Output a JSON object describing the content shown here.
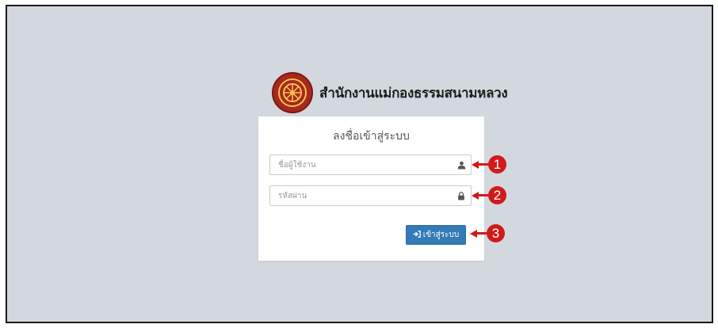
{
  "header": {
    "logo_icon": "dharma-wheel-seal-icon",
    "organization_name": "สำนักงานแม่กองธรรมสนามหลวง"
  },
  "login_form": {
    "title": "ลงชื่อเข้าสู่ระบบ",
    "username": {
      "placeholder": "ชื่อผู้ใช้งาน",
      "value": "",
      "icon": "user-icon"
    },
    "password": {
      "placeholder": "รหัสผ่าน",
      "value": "",
      "icon": "lock-icon"
    },
    "submit": {
      "label": "เข้าสู่ระบบ",
      "icon": "sign-in-icon"
    }
  },
  "annotations": [
    {
      "number": "1"
    },
    {
      "number": "2"
    },
    {
      "number": "3"
    }
  ],
  "colors": {
    "background": "#d3d7de",
    "button": "#337ab7",
    "annotation": "#d11a1a",
    "seal": "#a8281e"
  }
}
